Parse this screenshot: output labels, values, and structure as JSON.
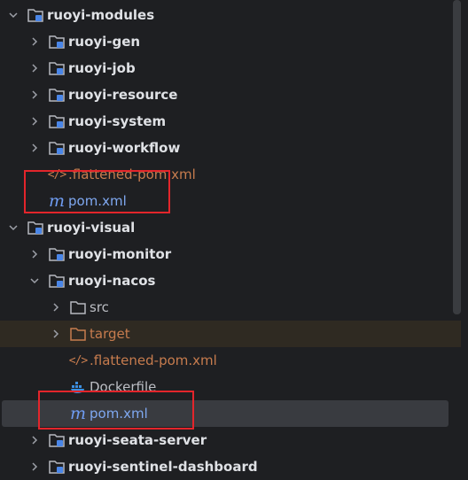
{
  "tree": {
    "r1": {
      "label": "ruoyi-modules"
    },
    "r2": {
      "label": "ruoyi-gen"
    },
    "r3": {
      "label": "ruoyi-job"
    },
    "r4": {
      "label": "ruoyi-resource"
    },
    "r5": {
      "label": "ruoyi-system"
    },
    "r6": {
      "label": "ruoyi-workflow"
    },
    "r7": {
      "label": ".flattened-pom.xml"
    },
    "r8": {
      "label": "pom.xml"
    },
    "r9": {
      "label": "ruoyi-visual"
    },
    "r10": {
      "label": "ruoyi-monitor"
    },
    "r11": {
      "label": "ruoyi-nacos"
    },
    "r12": {
      "label": "src"
    },
    "r13": {
      "label": "target"
    },
    "r14": {
      "label": ".flattened-pom.xml"
    },
    "r15": {
      "label": "Dockerfile"
    },
    "r16": {
      "label": "pom.xml"
    },
    "r17": {
      "label": "ruoyi-seata-server"
    },
    "r18": {
      "label": "ruoyi-sentinel-dashboard"
    }
  },
  "icons": {
    "maven_glyph": "m",
    "xml_glyph": "</>"
  },
  "colors": {
    "background": "#1e1f22",
    "selected_row": "#393b40",
    "excluded_row": "#2f2a22",
    "highlight_box": "#e3252b",
    "maven_icon": "#6f9cf2",
    "excluded_text": "#c77c4e"
  }
}
